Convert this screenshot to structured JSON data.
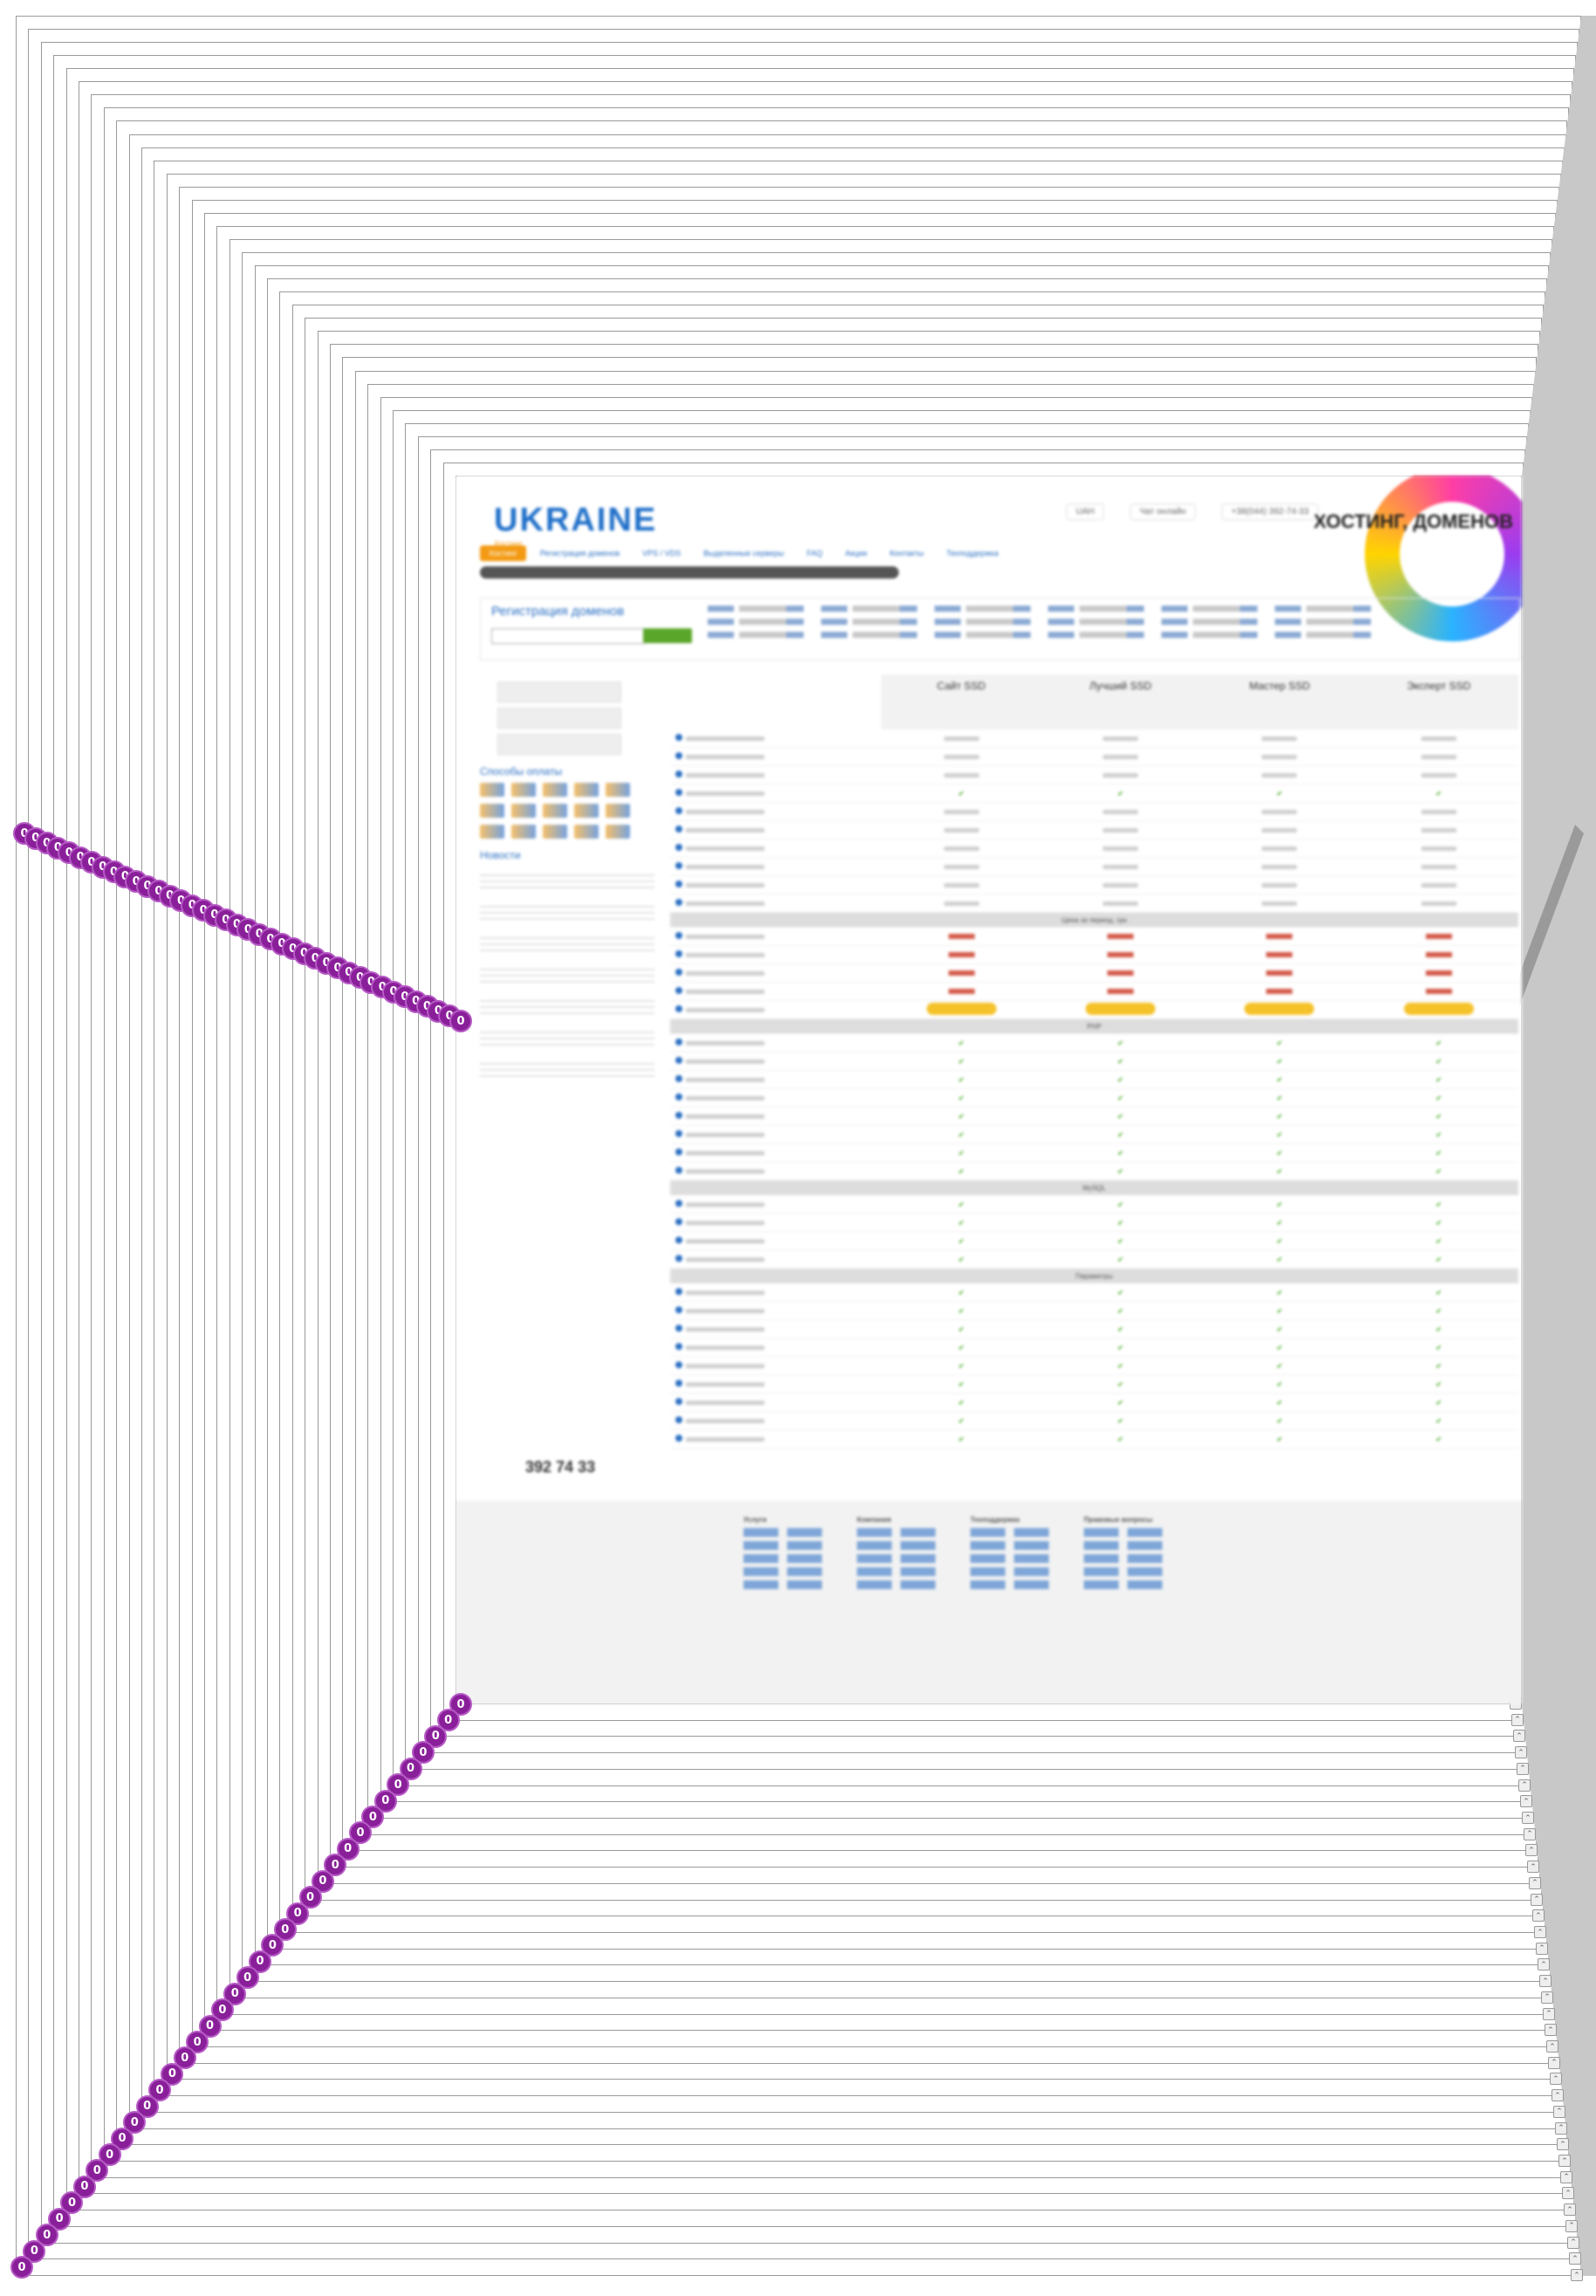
{
  "site": {
    "logo_text": "UKRAINE",
    "logo_tagline": "Хостинг",
    "promo_text": "ХОСТИНГ, ДОМЕНОВ",
    "nav": [
      "Хостинг",
      "Регистрация доменов",
      "VPS / VDS",
      "Выделенные серверы",
      "FAQ",
      "Акции",
      "Контакты",
      "Техподдержка"
    ],
    "top_info": [
      "UAH",
      "Чат онлайн",
      "+38(044) 392-74-33"
    ],
    "domain_reg_title": "Регистрация доменов",
    "sidebar_sections": [
      "Способы оплаты",
      "Новости"
    ],
    "plan_names": [
      "Сайт SSD",
      "Лучший SSD",
      "Мастер SSD",
      "Эксперт SSD"
    ],
    "section_titles": [
      "Цена за период, грн",
      "PHP",
      "MySQL",
      "Параметры"
    ],
    "footer_columns": [
      "Услуги",
      "Компания",
      "Техподдержка",
      "Правовые вопросы"
    ],
    "phone_number": "392 74 33"
  }
}
